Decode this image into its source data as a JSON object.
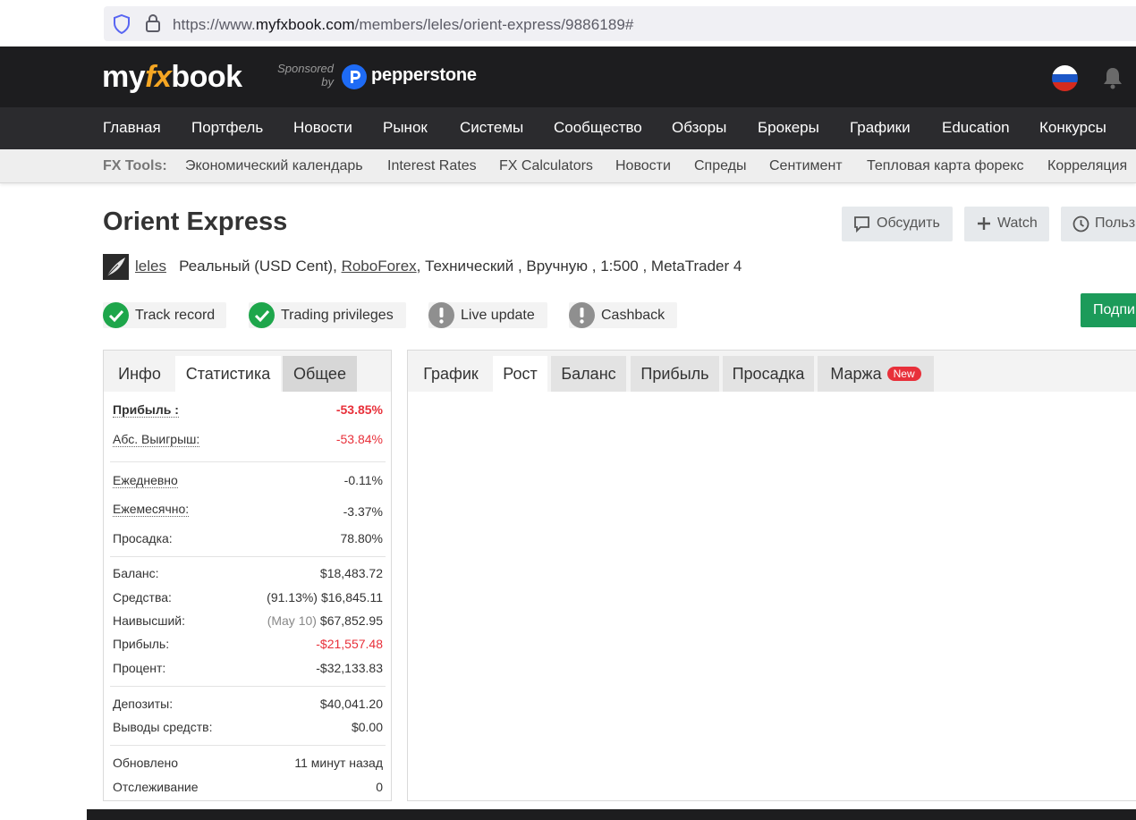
{
  "browser": {
    "url_prefix": "https://www.",
    "url_domain": "myfxbook.com",
    "url_path": "/members/leles/orient-express/9886189#"
  },
  "header": {
    "logo_my": "my",
    "logo_fx": "fx",
    "logo_book": "book",
    "sponsored_line1": "Sponsored",
    "sponsored_line2": "by",
    "sponsor_name": "pepperstone"
  },
  "main_nav": [
    "Главная",
    "Портфель",
    "Новости",
    "Рынок",
    "Системы",
    "Сообщество",
    "Обзоры",
    "Брокеры",
    "Графики",
    "Education",
    "Конкурсы"
  ],
  "tools_bar": {
    "label": "FX Tools:",
    "items": [
      "Экономический календарь",
      "Interest Rates",
      "FX Calculators",
      "Новости",
      "Спреды",
      "Сентимент",
      "Тепловая карта форекс",
      "Корреляция"
    ]
  },
  "system": {
    "title": "Orient Express",
    "buttons": {
      "discuss": "Обсудить",
      "watch": "Watch",
      "history": "Польз"
    },
    "username": "leles",
    "account_info_1": "Реальный (USD Cent),",
    "broker": "RoboForex",
    "account_info_2": ", Технический , Вручную , 1:500 , MetaTrader 4",
    "badges": [
      "Track record",
      "Trading privileges",
      "Live update",
      "Cashback"
    ],
    "subscribe_label": "Подпи"
  },
  "stats_panel": {
    "tabs": [
      "Инфо",
      "Статистика",
      "Общее"
    ],
    "rows": {
      "profit": {
        "label": "Прибыль :",
        "value": "-53.85%"
      },
      "abs_gain": {
        "label": "Абс. Выигрыш:",
        "value": "-53.84%"
      },
      "daily": {
        "label": "Ежедневно",
        "value": "-0.11%"
      },
      "monthly": {
        "label": "Ежемесячно:",
        "value": "-3.37%"
      },
      "drawdown": {
        "label": "Просадка:",
        "value": "78.80%"
      },
      "balance": {
        "label": "Баланс:",
        "value": "$18,483.72"
      },
      "equity": {
        "label": "Средства:",
        "note": "(91.13%)",
        "value": "$16,845.11"
      },
      "highest": {
        "label": "Наивысший:",
        "note": "(May 10)",
        "value": "$67,852.95"
      },
      "profit_abs": {
        "label": "Прибыль:",
        "value": "-$21,557.48"
      },
      "interest": {
        "label": "Процент:",
        "value": "-$32,133.83"
      },
      "deposits": {
        "label": "Депозиты:",
        "value": "$40,041.20"
      },
      "withdrawals": {
        "label": "Выводы средств:",
        "value": "$0.00"
      },
      "updated": {
        "label": "Обновлено",
        "value": "11 минут назад"
      },
      "tracking": {
        "label": "Отслеживание",
        "value": "0"
      }
    }
  },
  "chart_panel": {
    "tabs": [
      "График",
      "Рост",
      "Баланс",
      "Прибыль",
      "Просадка",
      "Маржа"
    ],
    "new_badge": "New"
  },
  "colors": {
    "accent_green": "#1ea64b",
    "negative_red": "#e8303a",
    "header_black": "#1d1d1f"
  }
}
